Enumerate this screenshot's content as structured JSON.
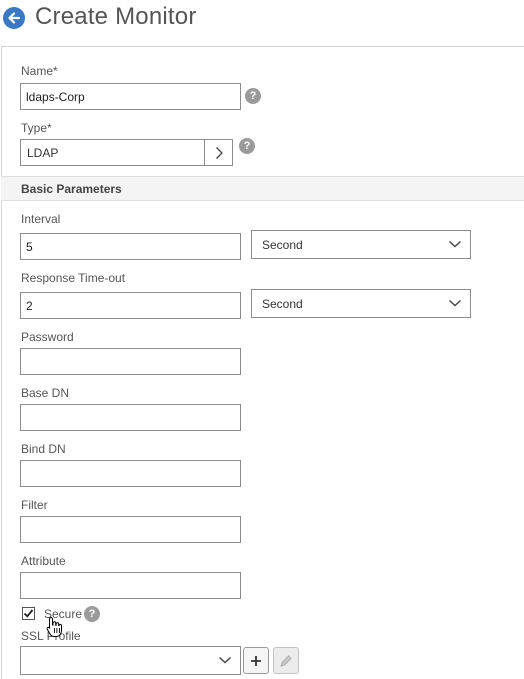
{
  "header": {
    "title": "Create Monitor"
  },
  "fields": {
    "name": {
      "label": "Name*",
      "value": "ldaps-Corp"
    },
    "type": {
      "label": "Type*",
      "value": "LDAP"
    },
    "interval": {
      "label": "Interval",
      "value": "5",
      "unit": "Second"
    },
    "response_timeout": {
      "label": "Response Time-out",
      "value": "2",
      "unit": "Second"
    },
    "password": {
      "label": "Password",
      "value": ""
    },
    "base_dn": {
      "label": "Base DN",
      "value": ""
    },
    "bind_dn": {
      "label": "Bind DN",
      "value": ""
    },
    "filter": {
      "label": "Filter",
      "value": ""
    },
    "attribute": {
      "label": "Attribute",
      "value": ""
    },
    "secure": {
      "label": "Secure",
      "checked": true
    },
    "ssl_profile": {
      "label": "SSL Profile",
      "value": ""
    }
  },
  "section": {
    "title": "Basic Parameters"
  },
  "help_glyph": "?",
  "colors": {
    "accent": "#3b78c4",
    "help": "#9a9a9a",
    "border": "#8c8c8c"
  }
}
